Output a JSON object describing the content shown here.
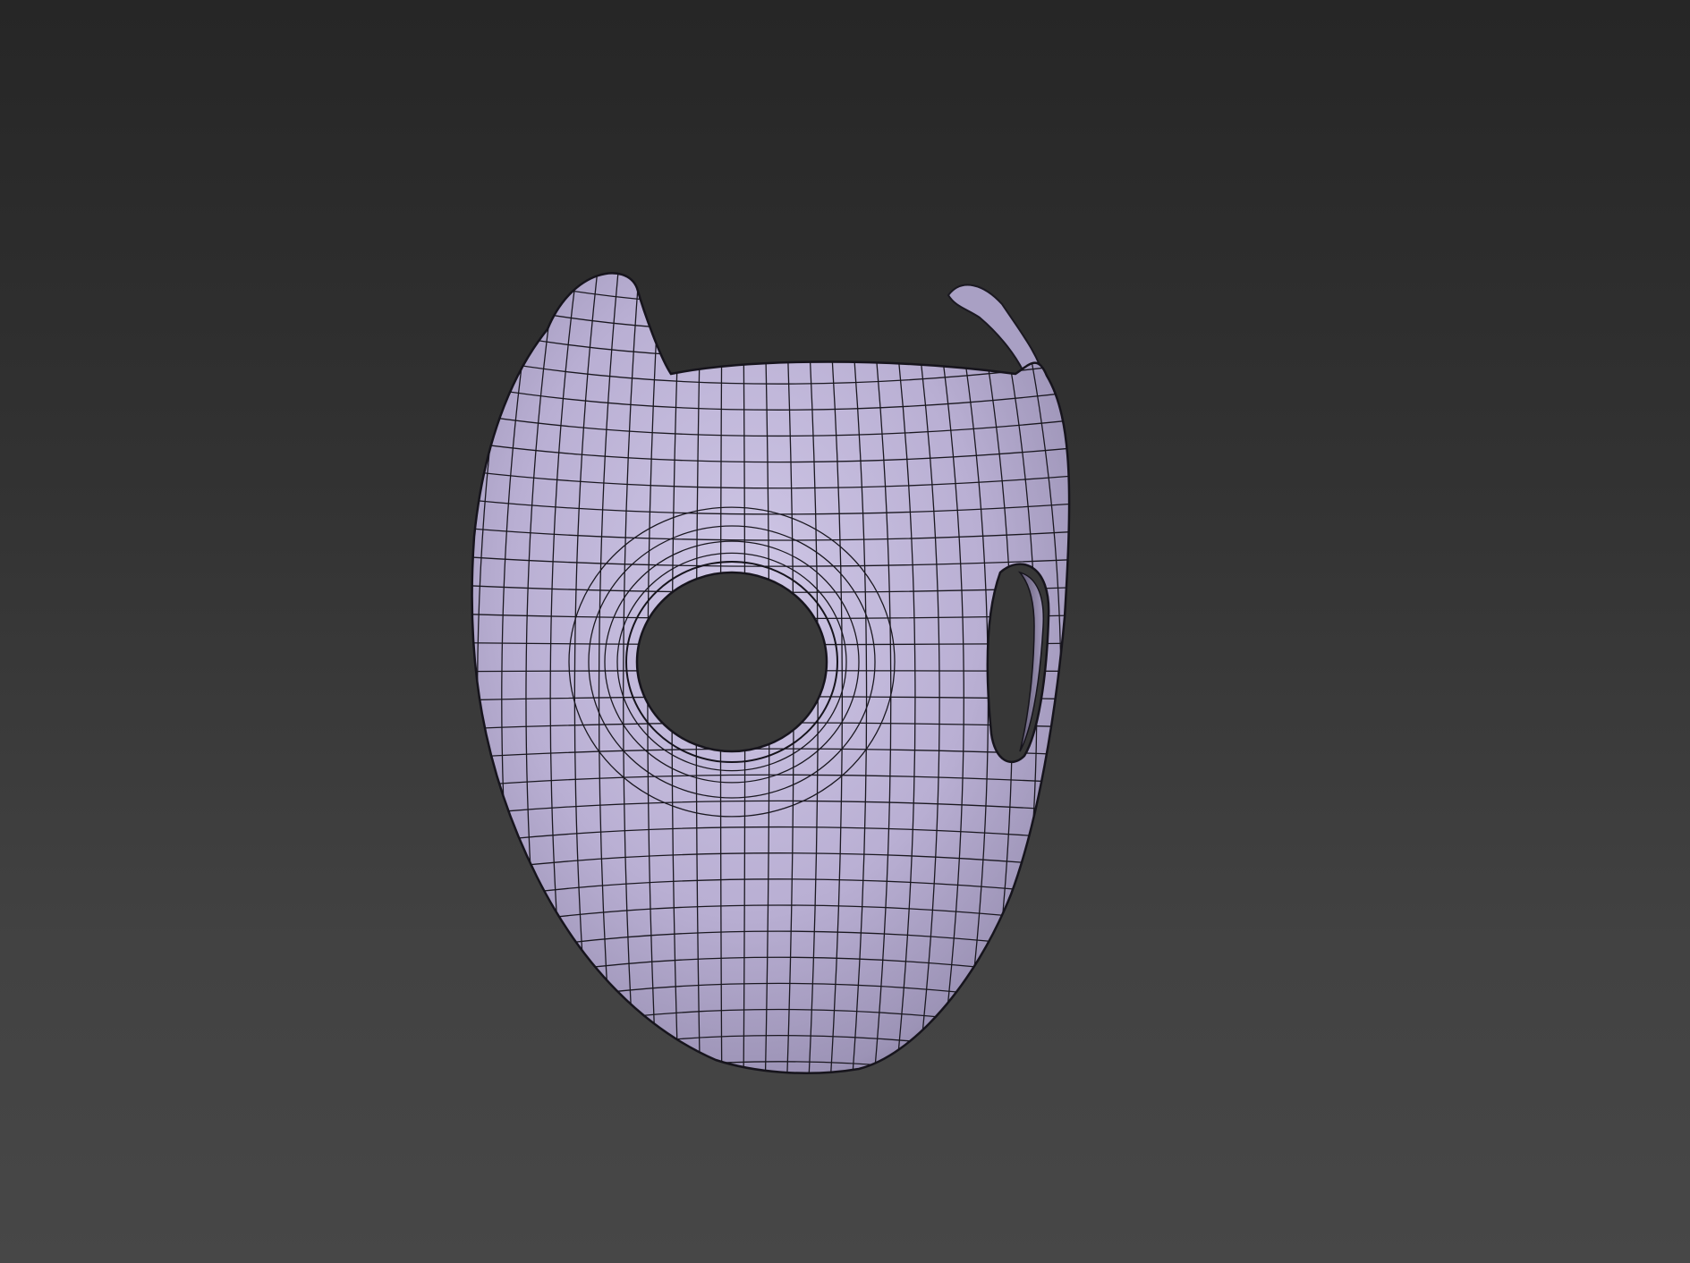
{
  "viewport": {
    "background_top": "#262626",
    "background_bottom": "#474747"
  },
  "model": {
    "shading": "wireframe-on-shaded",
    "material_color": "#bdb3d6",
    "shadow_color": "#6e6785",
    "wire_color": "#1a1820"
  }
}
